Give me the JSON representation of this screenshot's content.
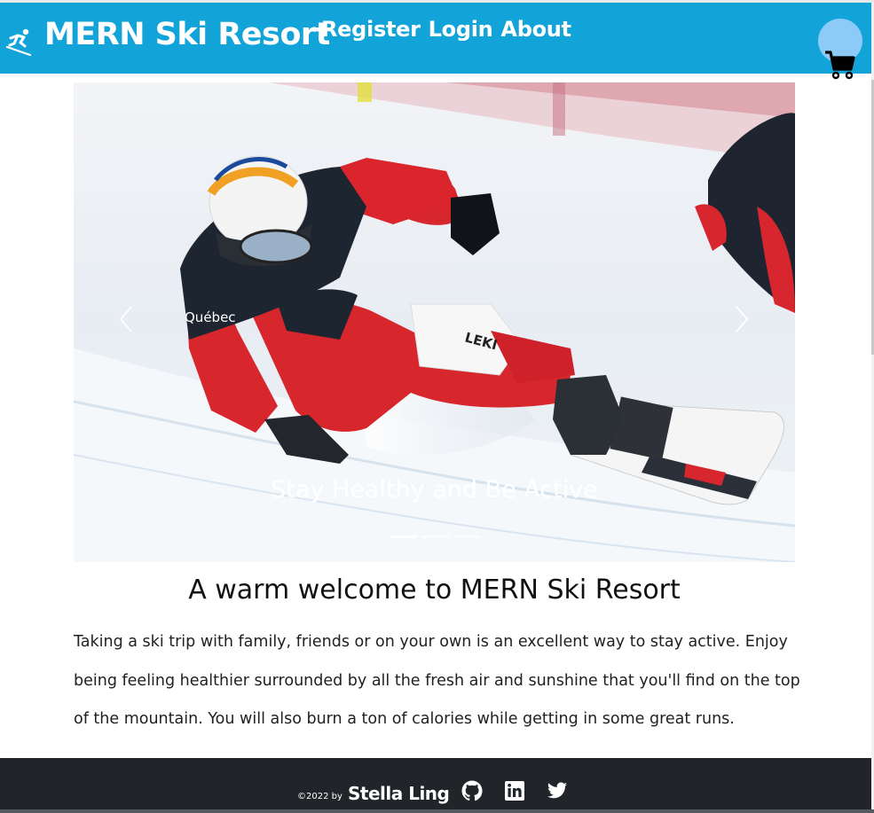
{
  "brand": {
    "name": "MERN Ski Resort",
    "icon": "skier-icon"
  },
  "nav": {
    "links": [
      "Register",
      "Login",
      "About"
    ]
  },
  "cart": {
    "icon": "cart-icon",
    "bubble_color": "#8ccbf7"
  },
  "colors": {
    "navbar": "#12a4d9",
    "footer": "#212529"
  },
  "carousel": {
    "caption": "Stay Healthy and Be Active",
    "slide_count": 3,
    "active_slide": 1,
    "prev_icon": "chevron-left-icon",
    "next_icon": "chevron-right-icon"
  },
  "main": {
    "heading": "A warm welcome to MERN Ski Resort",
    "paragraph": "Taking a ski trip with family, friends or on your own is an excellent way to stay active. Enjoy being feeling healthier surrounded by all the fresh air and sunshine that you'll find on the top of the mountain. You will also burn a ton of calories while getting in some great runs."
  },
  "footer": {
    "copyright": "©2022 by",
    "author": "Stella Ling",
    "social": [
      "github-icon",
      "linkedin-icon",
      "twitter-icon"
    ]
  }
}
